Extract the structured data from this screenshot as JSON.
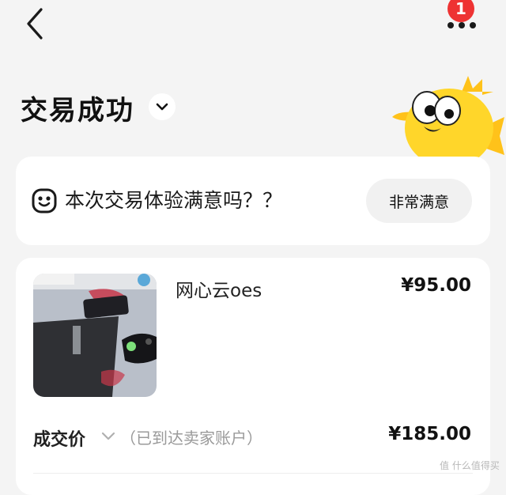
{
  "header": {
    "notification_count": "1"
  },
  "status": {
    "title": "交易成功"
  },
  "survey": {
    "question": "本次交易体验满意吗？？",
    "button_label": "非常满意"
  },
  "order": {
    "item_title": "网心云oes",
    "item_price": "¥95.00",
    "deal_label": "成交价",
    "deal_note": "（已到达卖家账户）",
    "deal_price": "¥185.00"
  },
  "watermark": "值 什么值得买",
  "colors": {
    "background": "#f4f4f4",
    "badge": "#ee3333",
    "mascot": "#ffd62a"
  }
}
